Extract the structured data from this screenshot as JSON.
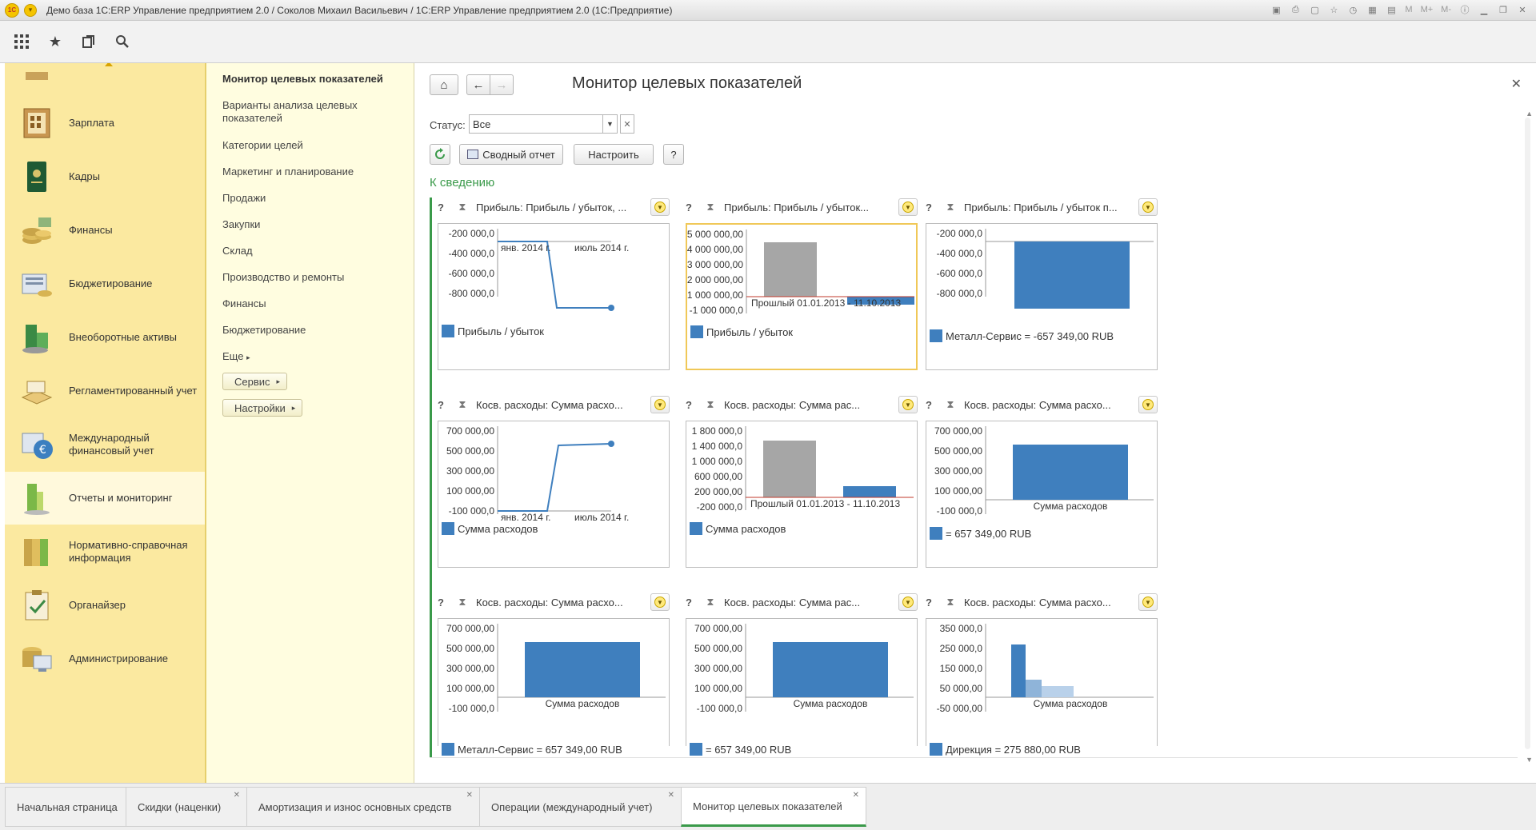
{
  "window": {
    "title": "Демо база 1С:ERP Управление предприятием 2.0 / Соколов Михаил Васильевич / 1С:ERP Управление предприятием 2.0  (1С:Предприятие)",
    "logo": "1С",
    "memory_buttons": [
      "M",
      "M+",
      "M-"
    ]
  },
  "sections": [
    {
      "label": "Зарплата",
      "icon": "salary-icon"
    },
    {
      "label": "Кадры",
      "icon": "personnel-icon"
    },
    {
      "label": "Финансы",
      "icon": "finance-icon"
    },
    {
      "label": "Бюджетирование",
      "icon": "budgeting-icon"
    },
    {
      "label": "Внеоборотные активы",
      "icon": "assets-icon"
    },
    {
      "label": "Регламентированный учет",
      "icon": "accounting-icon"
    },
    {
      "label": "Международный финансовый учет",
      "icon": "international-icon"
    },
    {
      "label": "Отчеты и мониторинг",
      "icon": "reports-icon"
    },
    {
      "label": "Нормативно-справочная информация",
      "icon": "reference-icon"
    },
    {
      "label": "Органайзер",
      "icon": "organizer-icon"
    },
    {
      "label": "Администрирование",
      "icon": "admin-icon"
    }
  ],
  "submenu": {
    "items": [
      "Монитор целевых показателей",
      "Варианты анализа целевых показателей",
      "Категории целей",
      "Маркетинг и планирование",
      "Продажи",
      "Закупки",
      "Склад",
      "Производство и ремонты",
      "Финансы",
      "Бюджетирование"
    ],
    "more": "Еще",
    "service": "Сервис",
    "settings": "Настройки"
  },
  "main": {
    "title": "Монитор целевых показателей",
    "status_label": "Статус:",
    "status_value": "Все",
    "summary_button": "Сводный отчет",
    "configure_button": "Настроить",
    "help_button": "?",
    "group_title": "К сведению"
  },
  "widgets": [
    {
      "title": "Прибыль: Прибыль / убыток, ...",
      "legend": "Прибыль / убыток",
      "ticks": [
        "-200 000,0",
        "-400 000,0",
        "-600 000,0",
        "-800 000,0"
      ],
      "xlabels": [
        "янв. 2014 г.",
        "июль 2014 г."
      ],
      "kind": "line-down"
    },
    {
      "title": "Прибыль: Прибыль / убыток...",
      "legend": "Прибыль / убыток",
      "ticks": [
        "5 000 000,00",
        "4 000 000,00",
        "3 000 000,00",
        "2 000 000,00",
        "1 000 000,00",
        "-1 000 000,0"
      ],
      "xlabels": [
        "Прошлый",
        "01.01.2013 - 11.10.2013"
      ],
      "kind": "bar-compare-1"
    },
    {
      "title": "Прибыль: Прибыль / убыток п...",
      "legend": "Металл-Сервис = -657 349,00 RUB",
      "ticks": [
        "-200 000,0",
        "-400 000,0",
        "-600 000,0",
        "-800 000,0"
      ],
      "xlabels": [],
      "kind": "bar-neg"
    },
    {
      "title": "Косв. расходы: Сумма расхо...",
      "legend": "Сумма расходов",
      "ticks": [
        "700 000,00",
        "500 000,00",
        "300 000,00",
        "100 000,00",
        "-100 000,0"
      ],
      "xlabels": [
        "янв. 2014 г.",
        "июль 2014 г."
      ],
      "kind": "line-up"
    },
    {
      "title": "Косв. расходы: Сумма рас...",
      "legend": "Сумма расходов",
      "ticks": [
        "1 800 000,0",
        "1 400 000,0",
        "1 000 000,0",
        "600 000,00",
        "200 000,00",
        "-200 000,0"
      ],
      "xlabels": [
        "Прошлый",
        "01.01.2013 - 11.10.2013"
      ],
      "kind": "bar-compare-2"
    },
    {
      "title": "Косв. расходы: Сумма расхо...",
      "legend": "= 657 349,00 RUB",
      "ticks": [
        "700 000,00",
        "500 000,00",
        "300 000,00",
        "100 000,00",
        "-100 000,0"
      ],
      "xlabels": [
        "Сумма расходов"
      ],
      "kind": "bar-single"
    },
    {
      "title": "Косв. расходы: Сумма расхо...",
      "legend": "Металл-Сервис = 657 349,00 RUB",
      "ticks": [
        "700 000,00",
        "500 000,00",
        "300 000,00",
        "100 000,00",
        "-100 000,0"
      ],
      "xlabels": [
        "Сумма расходов"
      ],
      "kind": "bar-single"
    },
    {
      "title": "Косв. расходы: Сумма рас...",
      "legend": "= 657 349,00 RUB",
      "ticks": [
        "700 000,00",
        "500 000,00",
        "300 000,00",
        "100 000,00",
        "-100 000,0"
      ],
      "xlabels": [
        "Сумма расходов"
      ],
      "kind": "bar-single"
    },
    {
      "title": "Косв. расходы: Сумма расхо...",
      "legend": "Дирекция = 275 880,00 RUB",
      "ticks": [
        "350 000,0",
        "250 000,0",
        "150 000,0",
        "50 000,00",
        "-50 000,00"
      ],
      "xlabels": [
        "Сумма расходов"
      ],
      "kind": "bar-multi"
    }
  ],
  "tabs": [
    {
      "label": "Начальная страница",
      "closable": false
    },
    {
      "label": "Скидки (наценки)",
      "closable": true
    },
    {
      "label": "Амортизация и износ основных средств",
      "closable": true
    },
    {
      "label": "Операции (международный учет)",
      "closable": true
    },
    {
      "label": "Монитор целевых показателей",
      "closable": true
    }
  ],
  "colors": {
    "section_bg": "#fbe9a0",
    "submenu_bg": "#fffde0",
    "accent_green": "#3a9a4a",
    "bar_blue": "#3f7fbe",
    "bar_gray": "#a6a6a6"
  }
}
